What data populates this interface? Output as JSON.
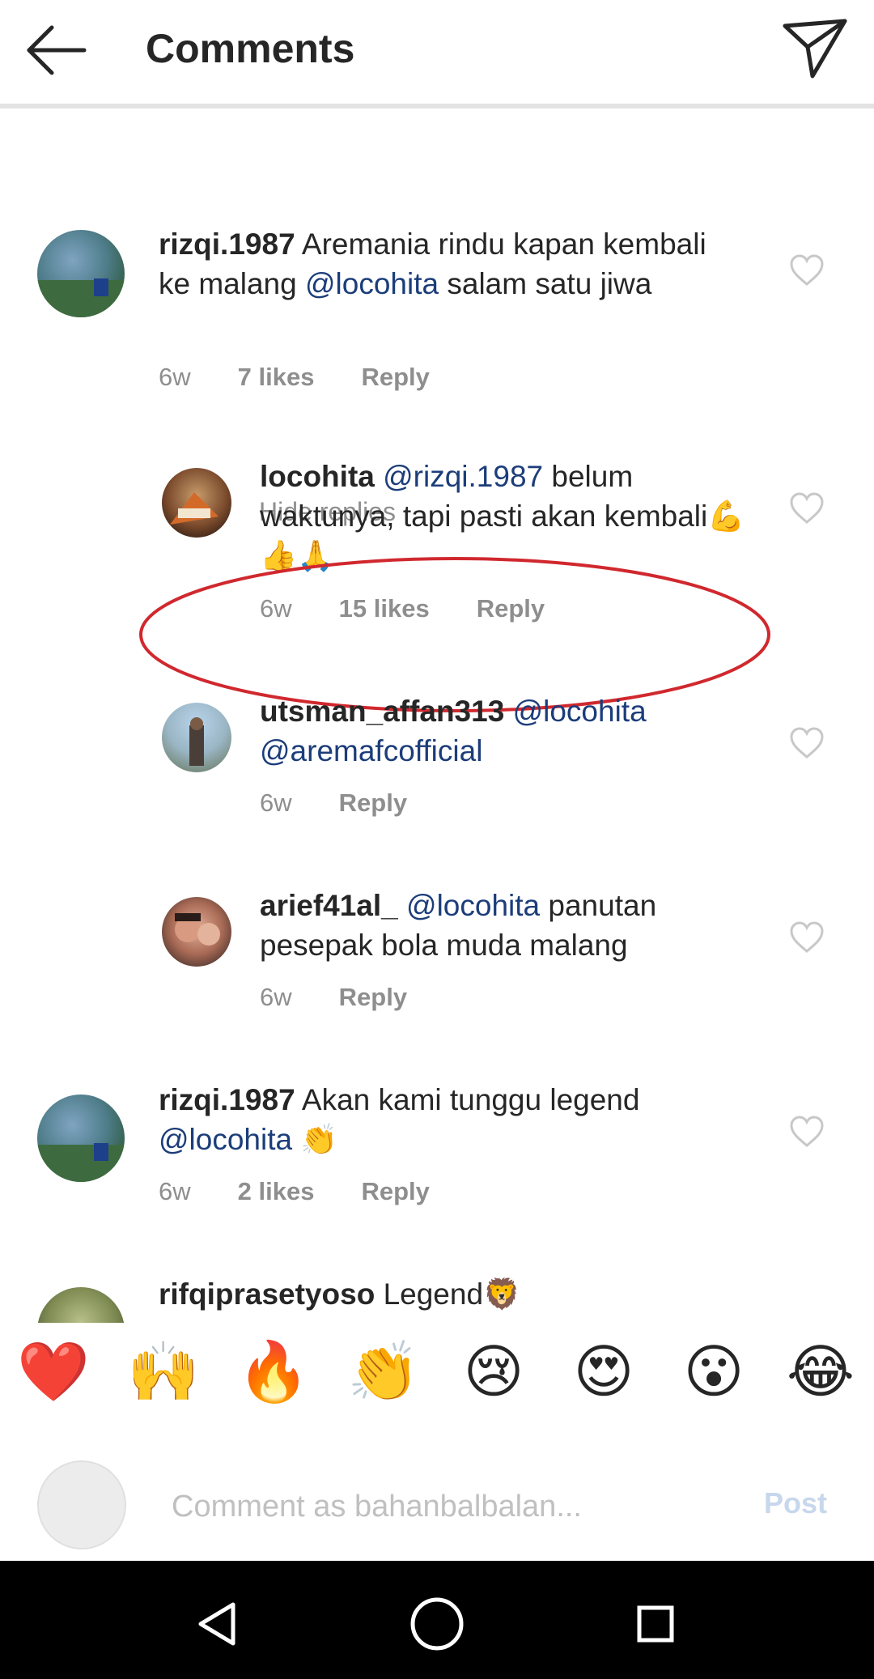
{
  "header": {
    "title": "Comments"
  },
  "hide_replies": "Hide replies",
  "comments": [
    {
      "username": "rizqi.1987",
      "segments": [
        {
          "t": " Aremania rindu kapan kembali ke malang ",
          "m": false
        },
        {
          "t": "@locohita",
          "m": true
        },
        {
          "t": " salam satu jiwa",
          "m": false
        }
      ],
      "time": "6w",
      "likes": "7 likes",
      "reply": "Reply"
    },
    {
      "username": "locohita",
      "segments": [
        {
          "t": " ",
          "m": false
        },
        {
          "t": "@rizqi.1987",
          "m": true
        },
        {
          "t": " belum waktunya, tapi pasti akan kembali💪👍🙏",
          "m": false
        }
      ],
      "time": "6w",
      "likes": "15 likes",
      "reply": "Reply"
    },
    {
      "username": "utsman_affan313",
      "segments": [
        {
          "t": " ",
          "m": false
        },
        {
          "t": "@locohita",
          "m": true
        },
        {
          "t": " ",
          "m": false
        },
        {
          "t": "@aremafcofficial",
          "m": true
        }
      ],
      "time": "6w",
      "likes": "",
      "reply": "Reply"
    },
    {
      "username": "arief41al_",
      "segments": [
        {
          "t": " ",
          "m": false
        },
        {
          "t": "@locohita",
          "m": true
        },
        {
          "t": " panutan pesepak bola muda malang",
          "m": false
        }
      ],
      "time": "6w",
      "likes": "",
      "reply": "Reply"
    },
    {
      "username": "rizqi.1987",
      "segments": [
        {
          "t": " Akan kami tunggu legend ",
          "m": false
        },
        {
          "t": "@locohita",
          "m": true
        },
        {
          "t": " 👏",
          "m": false
        }
      ],
      "time": "6w",
      "likes": "2 likes",
      "reply": "Reply"
    },
    {
      "username": "rifqiprasetyoso",
      "segments": [
        {
          "t": " Legend🦁",
          "m": false
        }
      ],
      "time": "",
      "likes": "",
      "reply": ""
    }
  ],
  "emoji_bar": [
    "❤️",
    "🙌",
    "🔥",
    "👏",
    "😢",
    "😍",
    "😮",
    "😂"
  ],
  "input": {
    "placeholder": "Comment as bahanbalbalan...",
    "post_label": "Post"
  },
  "colors": {
    "mention": "#1c3d7a",
    "meta": "#8e8e8e",
    "highlight": "#d0282e"
  },
  "icons": [
    "back-arrow-icon",
    "send-icon",
    "heart-outline-icon",
    "nav-back-icon",
    "nav-home-icon",
    "nav-recents-icon"
  ]
}
